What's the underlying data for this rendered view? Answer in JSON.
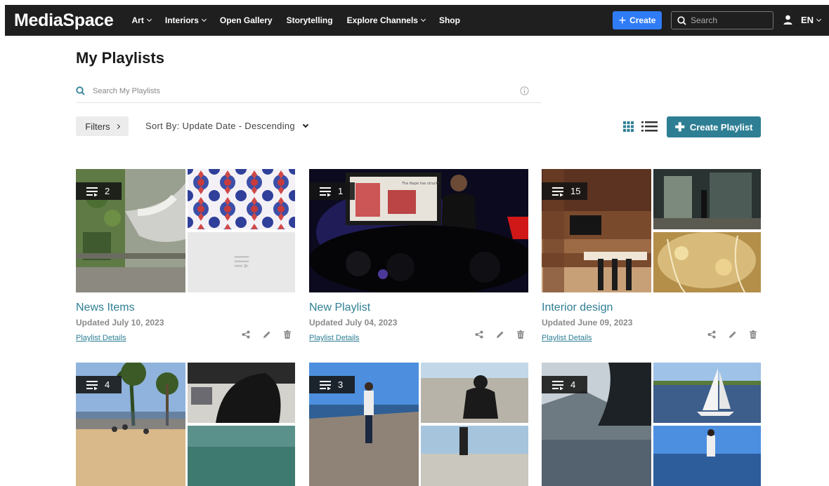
{
  "header": {
    "logo": "MediaSpace",
    "nav": [
      {
        "label": "Art",
        "dropdown": true
      },
      {
        "label": "Interiors",
        "dropdown": true
      },
      {
        "label": "Open Gallery",
        "dropdown": false
      },
      {
        "label": "Storytelling",
        "dropdown": false
      },
      {
        "label": "Explore Channels",
        "dropdown": true
      },
      {
        "label": "Shop",
        "dropdown": false
      }
    ],
    "create_label": "Create",
    "search_placeholder": "Search",
    "language": "EN"
  },
  "page": {
    "title": "My Playlists",
    "search_placeholder": "Search My Playlists",
    "filters_label": "Filters",
    "sort_label": "Sort By: Update Date - Descending",
    "create_playlist_label": "Create Playlist"
  },
  "colors": {
    "accent": "#2e7f94",
    "create_blue": "#2f7cf6",
    "topbar": "#1f1f1f"
  },
  "playlists": [
    {
      "title": "News Items",
      "date": "Updated July 10, 2023",
      "count": "2",
      "details": "Playlist Details"
    },
    {
      "title": "New Playlist",
      "date": "Updated July 04, 2023",
      "count": "1",
      "details": "Playlist Details"
    },
    {
      "title": "Interior design",
      "date": "Updated June 09, 2023",
      "count": "15",
      "details": "Playlist Details"
    },
    {
      "title": "",
      "date": "",
      "count": "4",
      "details": ""
    },
    {
      "title": "",
      "date": "",
      "count": "3",
      "details": ""
    },
    {
      "title": "",
      "date": "",
      "count": "4",
      "details": ""
    }
  ],
  "thumb_text": {
    "slide_caption": "The Nape has struck!"
  }
}
